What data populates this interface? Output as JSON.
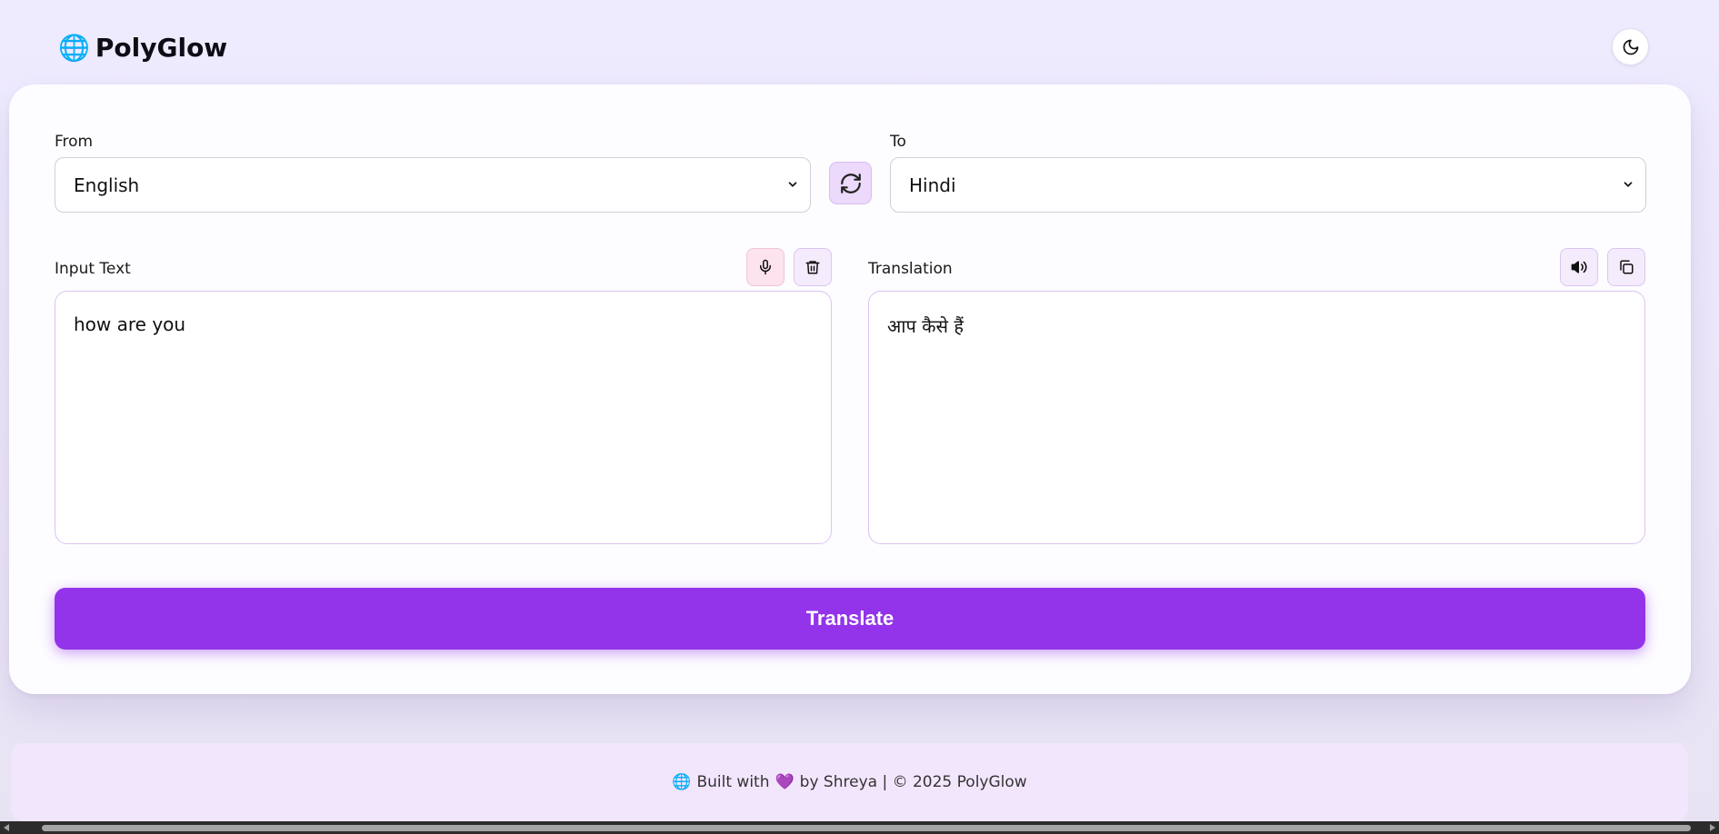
{
  "header": {
    "brand_icon": "🌐",
    "brand_title": "PolyGlow",
    "theme_toggle_icon": "moon-icon"
  },
  "languages": {
    "from_label": "From",
    "from_value": "English",
    "to_label": "To",
    "to_value": "Hindi",
    "swap_icon": "swap-arrows-icon"
  },
  "input": {
    "label": "Input Text",
    "value": "how are you",
    "mic_icon": "microphone-icon",
    "clear_icon": "trash-icon"
  },
  "output": {
    "label": "Translation",
    "value": "आप कैसे हैं",
    "speak_icon": "speaker-icon",
    "copy_icon": "copy-icon"
  },
  "actions": {
    "translate_label": "Translate"
  },
  "footer": {
    "globe": "🌐",
    "built_with": "Built with",
    "heart": "💜",
    "by_text": "by Shreya | © 2025 PolyGlow"
  },
  "colors": {
    "accent": "#9333ea",
    "swap_bg": "#ecd9fb",
    "mic_bg": "#fce3ee",
    "footer_bg": "#f2e6fd"
  }
}
